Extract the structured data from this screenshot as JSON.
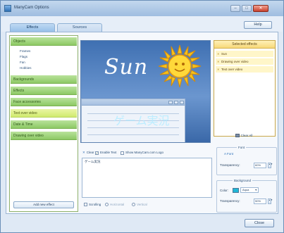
{
  "window": {
    "title": "ManyCam Options",
    "minimize_label": "–",
    "maximize_label": "□",
    "close_label": "✕"
  },
  "tabs": [
    {
      "label": "Effects",
      "active": true
    },
    {
      "label": "Sources",
      "active": false
    }
  ],
  "help_label": "Help",
  "effects_sidebar": {
    "groups": [
      {
        "label": "Objects",
        "subitems": [
          "Frames",
          "Flags",
          "Fan",
          "Hobbies"
        ]
      },
      {
        "label": "Backgrounds"
      },
      {
        "label": "Effects"
      },
      {
        "label": "Face accessories"
      },
      {
        "label": "Text over video"
      },
      {
        "label": "Date & Time"
      },
      {
        "label": "Drawing over video"
      }
    ],
    "add_effect_label": "Add new effect"
  },
  "preview": {
    "sun_text": "Sun",
    "overlay_text": "ゲーム実況"
  },
  "selected_effects": {
    "header": "Selected effects",
    "items": [
      "Sun",
      "Drawing over video",
      "Text over video"
    ],
    "clear_all_label": "Clear All"
  },
  "text_editor": {
    "clear_label": "Clear",
    "enable_text_label": "Enable Text",
    "enable_text_checked": true,
    "show_logo_label": "Show ManyCam.com Logo",
    "show_logo_checked": false,
    "content": "ゲーム実況",
    "scrolling_label": "Scrolling",
    "horizontal_label": "Horizontal",
    "vertical_label": "Vertical"
  },
  "font_group": {
    "title": "Font",
    "font_link": "Font",
    "transparency_label": "Transparency:",
    "transparency_value": "60%"
  },
  "background_group": {
    "title": "Background",
    "color_label": "Color:",
    "color_value": "Aqua",
    "color_hex": "#1fb7d6",
    "transparency_label": "Transparency:",
    "transparency_value": "50%"
  },
  "close_label": "Close",
  "colors": {
    "window_bg": "#dfe9f5",
    "group_green": "#8dc965",
    "group_yellow": "#d0ea6f",
    "selected_header": "#f7d879"
  }
}
